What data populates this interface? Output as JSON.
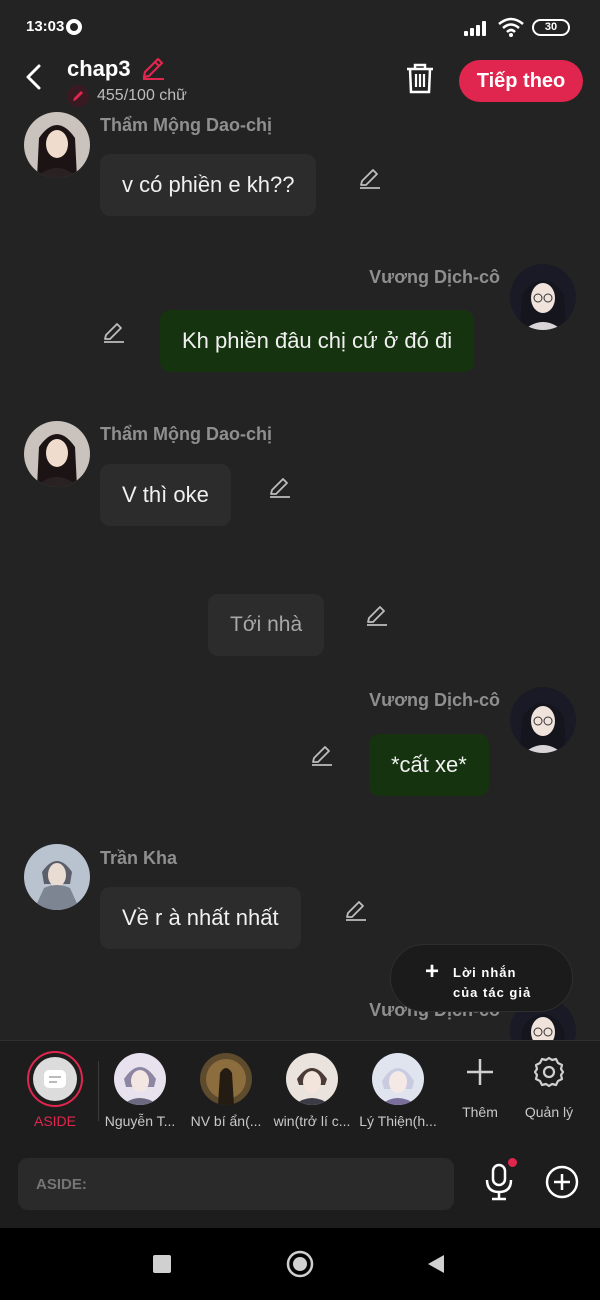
{
  "status_bar": {
    "time": "13:03",
    "battery": "30"
  },
  "header": {
    "title": "chap3",
    "word_count": "455/100 chữ",
    "next_label": "Tiếp theo",
    "accent": "#e0264e"
  },
  "messages": [
    {
      "side": "left",
      "sender": "Thẩm Mộng Dao-chị",
      "text": "v có phiền e kh??"
    },
    {
      "side": "right",
      "sender": "Vương Dịch-cô",
      "text": "Kh phiền đâu chị cứ ở đó đi"
    },
    {
      "side": "left",
      "sender": "Thẩm Mộng Dao-chị",
      "text": "V thì oke"
    },
    {
      "side": "center",
      "text": "Tới nhà"
    },
    {
      "side": "right",
      "sender": "Vương Dịch-cô",
      "text": "*cất xe*"
    },
    {
      "side": "left",
      "sender": "Trần Kha",
      "text": "Về r à nhất nhất"
    },
    {
      "side": "right",
      "sender": "Vương Dịch-cô",
      "text": ""
    }
  ],
  "author_note": {
    "line1": "Lời nhắn",
    "line2": "của tác giả"
  },
  "characters": {
    "aside": "ASIDE",
    "items": [
      {
        "label": "Nguyễn T..."
      },
      {
        "label": "NV bí ẩn(..."
      },
      {
        "label": "win(trở lí c..."
      },
      {
        "label": "Lý Thiện(h..."
      }
    ],
    "add_label": "Thêm",
    "manage_label": "Quản lý"
  },
  "input": {
    "placeholder": "ASIDE:"
  },
  "colors": {
    "bubble_left": "#2c2c2c",
    "bubble_right": "#16330f",
    "background": "#232323"
  }
}
